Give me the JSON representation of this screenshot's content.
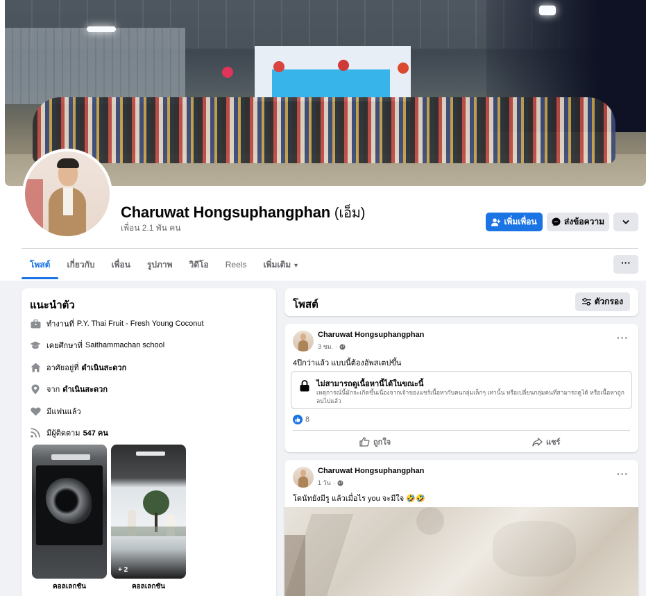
{
  "profile": {
    "name": "Charuwat Hongsuphangphan",
    "alt_name": "(เอ็ม)",
    "friends": "เพื่อน 2.1 พัน คน",
    "add_friend_label": "เพิ่มเพื่อน",
    "message_label": "ส่งข้อความ"
  },
  "tabs": [
    {
      "label": "โพสต์"
    },
    {
      "label": "เกี่ยวกับ"
    },
    {
      "label": "เพื่อน"
    },
    {
      "label": "รูปภาพ"
    },
    {
      "label": "วิดีโอ"
    },
    {
      "label": "Reels"
    },
    {
      "label": "เพิ่มเติม"
    }
  ],
  "intro": {
    "title": "แนะนำตัว",
    "work_prefix": "ทำงานที่",
    "work": "P.Y. Thai Fruit - Fresh Young Coconut",
    "study_prefix": "เคยศึกษาที่",
    "study": "Saithammachan school",
    "lives_prefix": "อาศัยอยู่ที่",
    "lives": "ดำเนินสะดวก",
    "from_prefix": "จาก",
    "from": "ดำเนินสะดวก",
    "relationship": "มีแฟนแล้ว",
    "followers_prefix": "มีผู้ติดตาม",
    "followers": "547 คน",
    "stories": [
      {
        "label": "คอลเลกชัน",
        "badge": ""
      },
      {
        "label": "คอลเลกชัน",
        "badge": "+ 2"
      }
    ]
  },
  "posts_section": {
    "title": "โพสต์",
    "filter_label": "ตัวกรอง"
  },
  "posts": [
    {
      "author": "Charuwat Hongsuphangphan",
      "time": "3 ชม.",
      "dot": "·",
      "text": "4ปีกว่าแล้ว แบบนี้ต้องอัพสเตปขึ้น",
      "unavailable_title": "ไม่สามารถดูเนื้อหานี้ได้ในขณะนี้",
      "unavailable_desc": "เหตุการณ์นี้มักจะเกิดขึ้นเนื่องจากเจ้าของแชร์เนื้อหากับคนกลุ่มเล็กๆ เท่านั้น หรือเปลี่ยนกลุ่มคนที่สามารถดูได้ หรือเนื้อหาถูกลบไปแล้ว",
      "likes": "8",
      "like_label": "ถูกใจ",
      "share_label": "แชร์"
    },
    {
      "author": "Charuwat Hongsuphangphan",
      "time": "1 วัน",
      "dot": "·",
      "text": "โดนัทยังมีรู แล้วเมื่อไร you จะมีใจ 🤣🤣"
    }
  ],
  "colors": {
    "accent": "#1b74e4",
    "background": "#f0f2f5",
    "secondary_text": "#65676b"
  }
}
